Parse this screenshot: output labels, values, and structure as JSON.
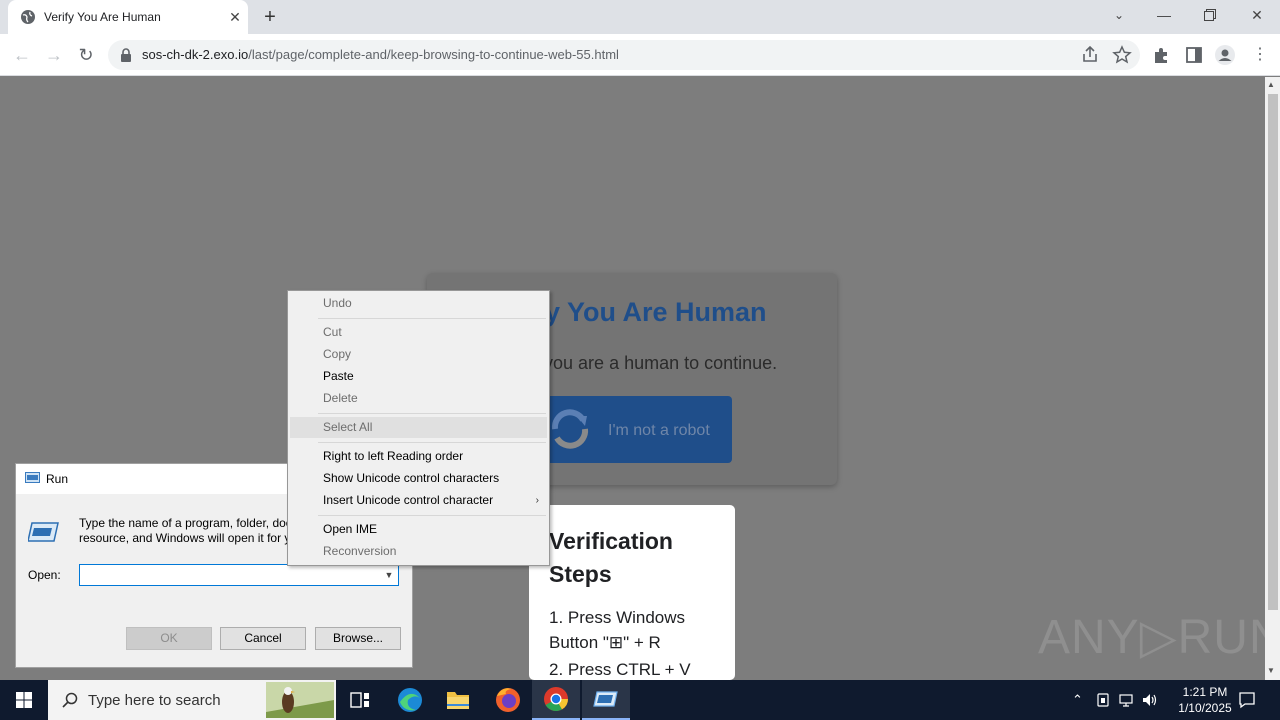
{
  "browser": {
    "tab_title": "Verify You Are Human",
    "url_host": "sos-ch-dk-2.exo.io",
    "url_path": "/last/page/complete-and/keep-browsing-to-continue-web-55.html"
  },
  "page": {
    "heading": "y You Are Human",
    "subtitle": "that you are a human to continue.",
    "robot_button": "I'm not a robot",
    "steps_title": "Verification Steps",
    "step1": "1. Press Windows Button \"⊞\" + R",
    "step2": "2. Press CTRL + V",
    "watermark": "ANY▷RUN"
  },
  "run_dialog": {
    "title": "Run",
    "description_line1": "Type the name of a program, folder, doc",
    "description_line2": "resource, and Windows will open it for y",
    "open_label": "Open:",
    "open_value": "",
    "ok": "OK",
    "cancel": "Cancel",
    "browse": "Browse..."
  },
  "context_menu": {
    "undo": "Undo",
    "cut": "Cut",
    "copy": "Copy",
    "paste": "Paste",
    "delete": "Delete",
    "select_all": "Select All",
    "rtl": "Right to left Reading order",
    "show_unicode": "Show Unicode control characters",
    "insert_unicode": "Insert Unicode control character",
    "open_ime": "Open IME",
    "reconversion": "Reconversion"
  },
  "taskbar": {
    "search_placeholder": "Type here to search",
    "time": "1:21 PM",
    "date": "1/10/2025"
  },
  "colors": {
    "accent_blue": "#1f4e8a",
    "taskbar": "#0f1a2e"
  }
}
